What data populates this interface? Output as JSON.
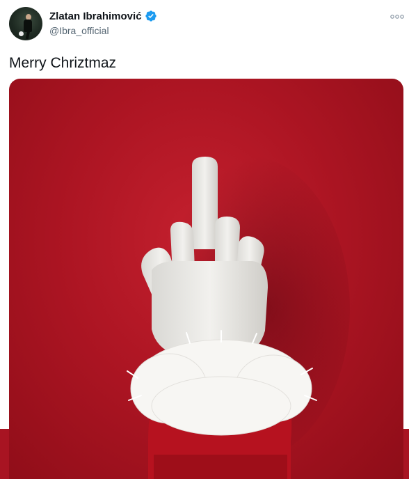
{
  "tweet": {
    "author": {
      "name": "Zlatan Ibrahimović",
      "handle": "@Ibra_official",
      "verified": true
    },
    "text": "Merry Chriztmaz",
    "menu_icon": "more-horizontal-icon"
  },
  "colors": {
    "name": "#0f1419",
    "handle": "#536471",
    "verified_badge": "#1d9bf0",
    "photo_background": "#b01826"
  }
}
